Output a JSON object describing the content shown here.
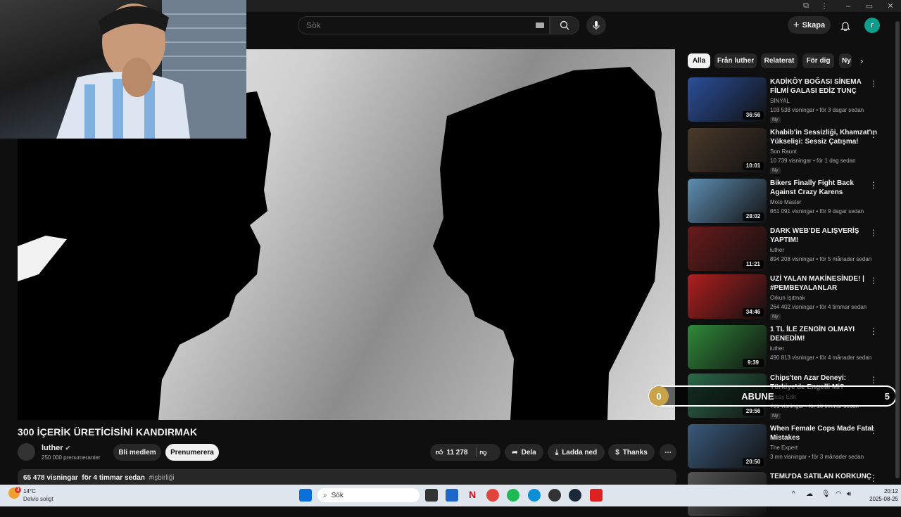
{
  "search": {
    "placeholder": "Sök"
  },
  "header": {
    "create_label": "Skapa",
    "avatar_letter": "r"
  },
  "video": {
    "title": "300 İÇERİK ÜRETİCİSİNİ KANDIRMAK",
    "channel": "luther",
    "subscribers": "250 000 prenumeranter",
    "join_label": "Bli medlem",
    "subscribe_label": "Prenumerera",
    "likes": "11 278",
    "share_label": "Dela",
    "download_label": "Ladda ned",
    "thanks_label": "Thanks",
    "views": "65 478 visningar",
    "age": "för 4 timmar sedan",
    "hashtag": "#işbirliği"
  },
  "chips": [
    "Alla",
    "Från luther",
    "Relaterat",
    "För dig",
    "Ny"
  ],
  "recommendations": [
    {
      "title": "KADİKÖY BOĞASI SİNEMA FİLMİ GALASI EDİZ TUNÇ",
      "channel": "SİNYAL",
      "views": "103 538 visningar",
      "age": "för 3 dagar sedan",
      "duration": "36:56",
      "badge": "Ny",
      "color": "#2b4f9a"
    },
    {
      "title": "Khabib'in Sessizliği, Khamzat'ın Yükselişi: Sessiz Çatışma!",
      "channel": "Son Raunt",
      "views": "10 739 visningar",
      "age": "för 1 dag sedan",
      "duration": "10:01",
      "badge": "Ny",
      "color": "#4a3a2a"
    },
    {
      "title": "Bikers Finally Fight Back Against Crazy Karens",
      "channel": "Moto Master",
      "views": "861 091 visningar",
      "age": "för 9 dagar sedan",
      "duration": "28:02",
      "badge": "",
      "color": "#5f8fb3"
    },
    {
      "title": "DARK WEB'DE ALIŞVERİŞ YAPTIM!",
      "channel": "luther",
      "views": "894 208 visningar",
      "age": "för 5 månader sedan",
      "duration": "11:21",
      "badge": "",
      "color": "#6a1a1a"
    },
    {
      "title": "UZİ YALAN MAKİNESİNDE! | #PEMBEYALANLAR",
      "channel": "Orkun Işıtmak",
      "views": "264 402 visningar",
      "age": "för 4 timmar sedan",
      "duration": "34:46",
      "badge": "Ny",
      "color": "#b01f1f"
    },
    {
      "title": "1 TL İLE ZENGİN OLMAYI DENEDİM!",
      "channel": "luther",
      "views": "490 813 visningar",
      "age": "för 4 månader sedan",
      "duration": "9:39",
      "badge": "",
      "color": "#2f8a3a"
    },
    {
      "title": "Chips'ten Azar Deneyi: Türkiye'de Engelli Mi?",
      "channel": "Olcay Edit",
      "views": "791 visningar",
      "age": "för 10 timmar sedan",
      "duration": "29:56",
      "badge": "Ny",
      "color": "#2a6a4a"
    },
    {
      "title": "When Female Cops Made Fatal Mistakes",
      "channel": "The Expert",
      "views": "3 mn visningar",
      "age": "för 3 månader sedan",
      "duration": "20:50",
      "badge": "",
      "color": "#3a5a7a"
    },
    {
      "title": "TEMU'DA SATILAN KORKUNÇ",
      "channel": "",
      "views": "",
      "age": "",
      "duration": "",
      "badge": "",
      "color": "#555"
    }
  ],
  "overlay": {
    "left_count": "0",
    "label": "ABUNE",
    "right_count": "5"
  },
  "taskbar": {
    "temp": "14°C",
    "weather": "Delvis soligt",
    "weather_badge": "3",
    "search_placeholder": "Sök",
    "time": "20:12",
    "date": "2025-08-25"
  }
}
